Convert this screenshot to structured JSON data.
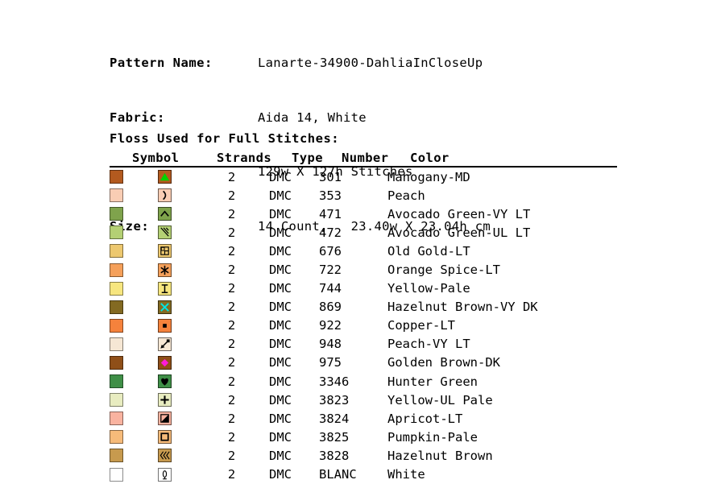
{
  "header": {
    "rows": [
      {
        "label": "Pattern Name:",
        "value": "Lanarte-34900-DahliaInCloseUp"
      },
      {
        "label": "Fabric:",
        "value": "Aida 14, White"
      },
      {
        "label": "",
        "value": "129w X 127h Stitches"
      },
      {
        "label": "Size:",
        "value": "14 Count,   23.40w X 23.04h cm"
      }
    ]
  },
  "section": {
    "title": "Floss Used for Full Stitches:"
  },
  "table": {
    "columns": {
      "symbol": "Symbol",
      "strands": "Strands",
      "type": "Type",
      "number": "Number",
      "color": "Color"
    },
    "rows": [
      {
        "swatch": "#b35a1f",
        "symbol_bg": "#b35a1f",
        "symbol": "triangle-up-icon",
        "symbol_color": "#00d400",
        "strands": "2",
        "type": "DMC",
        "number": "301",
        "color": "Mahogany-MD"
      },
      {
        "swatch": "#f9cdb4",
        "symbol_bg": "#f9cdb4",
        "symbol": "right-paren-icon",
        "symbol_color": "#000000",
        "strands": "2",
        "type": "DMC",
        "number": "353",
        "color": "Peach"
      },
      {
        "swatch": "#7fa34c",
        "symbol_bg": "#7fa34c",
        "symbol": "caret-up-icon",
        "symbol_color": "#000000",
        "strands": "2",
        "type": "DMC",
        "number": "471",
        "color": "Avocado Green-VY LT"
      },
      {
        "swatch": "#b4d074",
        "symbol_bg": "#b4d074",
        "symbol": "diagonal-lines-icon",
        "symbol_color": "#000000",
        "strands": "2",
        "type": "DMC",
        "number": "472",
        "color": "Avocado Green-UL LT"
      },
      {
        "swatch": "#edc86f",
        "symbol_bg": "#edc86f",
        "symbol": "flag-box-icon",
        "symbol_color": "#000000",
        "strands": "2",
        "type": "DMC",
        "number": "676",
        "color": "Old Gold-LT"
      },
      {
        "swatch": "#f5a05a",
        "symbol_bg": "#f5a05a",
        "symbol": "asterisk-icon",
        "symbol_color": "#000000",
        "strands": "2",
        "type": "DMC",
        "number": "722",
        "color": "Orange Spice-LT"
      },
      {
        "swatch": "#f7e67f",
        "symbol_bg": "#f7e67f",
        "symbol": "i-beam-icon",
        "symbol_color": "#000000",
        "strands": "2",
        "type": "DMC",
        "number": "744",
        "color": "Yellow-Pale"
      },
      {
        "swatch": "#836a22",
        "symbol_bg": "#836a22",
        "symbol": "cross-x-icon",
        "symbol_color": "#00e5e5",
        "strands": "2",
        "type": "DMC",
        "number": "869",
        "color": "Hazelnut Brown-VY DK"
      },
      {
        "swatch": "#f5823c",
        "symbol_bg": "#f5823c",
        "symbol": "dot-square-icon",
        "symbol_color": "#000000",
        "strands": "2",
        "type": "DMC",
        "number": "922",
        "color": "Copper-LT"
      },
      {
        "swatch": "#f6e7d4",
        "symbol_bg": "#f6e7d4",
        "symbol": "pin-arrow-icon",
        "symbol_color": "#000000",
        "strands": "2",
        "type": "DMC",
        "number": "948",
        "color": "Peach-VY LT"
      },
      {
        "swatch": "#8f4f18",
        "symbol_bg": "#8f4f18",
        "symbol": "diamond-icon",
        "symbol_color": "#ff1ad9",
        "strands": "2",
        "type": "DMC",
        "number": "975",
        "color": "Golden Brown-DK"
      },
      {
        "swatch": "#3f8f47",
        "symbol_bg": "#3f8f47",
        "symbol": "heart-icon",
        "symbol_color": "#000000",
        "strands": "2",
        "type": "DMC",
        "number": "3346",
        "color": "Hunter Green"
      },
      {
        "swatch": "#e8ecc0",
        "symbol_bg": "#e8ecc0",
        "symbol": "plus-icon",
        "symbol_color": "#000000",
        "strands": "2",
        "type": "DMC",
        "number": "3823",
        "color": "Yellow-UL Pale"
      },
      {
        "swatch": "#f9b3a0",
        "symbol_bg": "#f9b3a0",
        "symbol": "half-square-icon",
        "symbol_color": "#000000",
        "strands": "2",
        "type": "DMC",
        "number": "3824",
        "color": "Apricot-LT"
      },
      {
        "swatch": "#f6bb7a",
        "symbol_bg": "#f6bb7a",
        "symbol": "open-square-icon",
        "symbol_color": "#000000",
        "strands": "2",
        "type": "DMC",
        "number": "3825",
        "color": "Pumpkin-Pale"
      },
      {
        "swatch": "#c79a4e",
        "symbol_bg": "#c79a4e",
        "symbol": "triple-chevron-icon",
        "symbol_color": "#000000",
        "strands": "2",
        "type": "DMC",
        "number": "3828",
        "color": "Hazelnut Brown"
      },
      {
        "swatch": "#ffffff",
        "symbol_bg": "#ffffff",
        "symbol": "candle-icon",
        "symbol_color": "#000000",
        "strands": "2",
        "type": "DMC",
        "number": "BLANC",
        "color": "White"
      }
    ]
  }
}
